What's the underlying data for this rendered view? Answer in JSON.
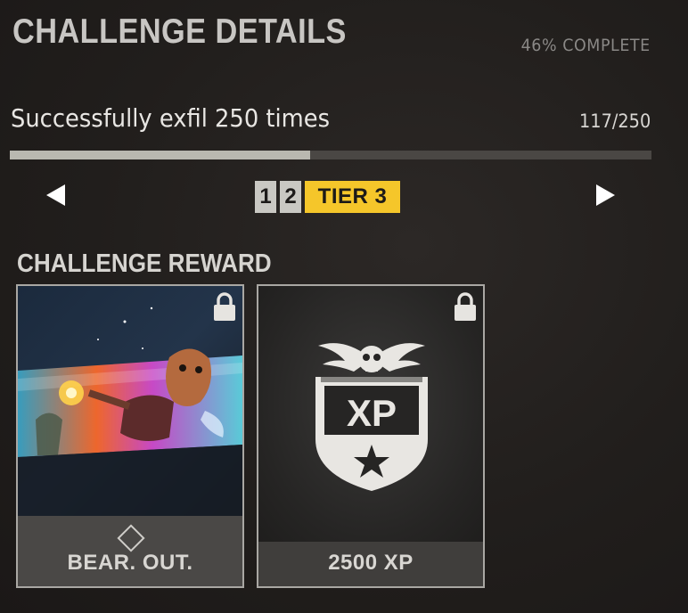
{
  "header": {
    "title": "CHALLENGE DETAILS",
    "percent_complete": "46% COMPLETE"
  },
  "challenge": {
    "description": "Successfully exfil 250 times",
    "progress_text": "117/250",
    "progress_fraction": 0.468
  },
  "tiers": {
    "items": [
      "1",
      "2"
    ],
    "active_label": "TIER 3"
  },
  "rewards": {
    "title": "CHALLENGE REWARD",
    "cards": [
      {
        "label": "BEAR. OUT.",
        "locked": true,
        "icon": "diamond-icon"
      },
      {
        "label": "2500 XP",
        "locked": true,
        "badge_text": "XP",
        "icon": "xp-shield-icon"
      }
    ]
  },
  "colors": {
    "accent": "#f5c62a",
    "progress_fill": "#b9b8b0",
    "progress_track": "#4a4744"
  }
}
